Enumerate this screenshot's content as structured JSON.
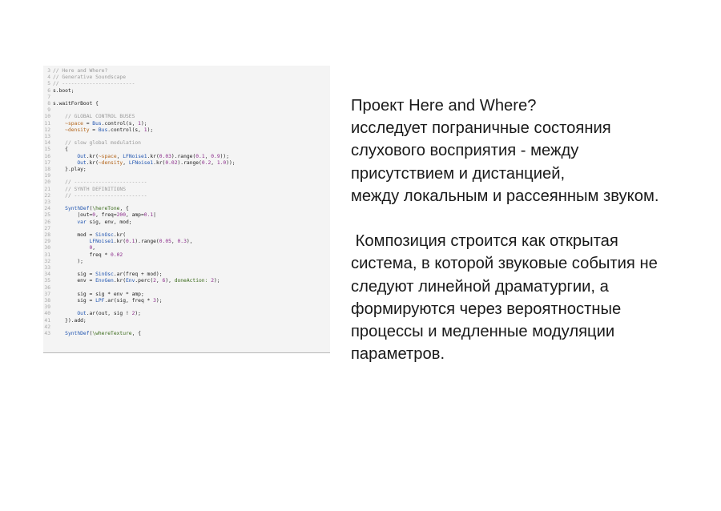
{
  "code": {
    "lines": [
      {
        "n": "3",
        "tokens": [
          {
            "t": "// Here and Where?",
            "c": "comment"
          }
        ]
      },
      {
        "n": "4",
        "tokens": [
          {
            "t": "// Generative Soundscape",
            "c": "comment"
          }
        ]
      },
      {
        "n": "5",
        "tokens": [
          {
            "t": "// ------------------------",
            "c": "comment"
          }
        ]
      },
      {
        "n": "6",
        "tokens": [
          {
            "t": "s.boot;",
            "c": "plain"
          }
        ]
      },
      {
        "n": "7",
        "tokens": []
      },
      {
        "n": "8",
        "tokens": [
          {
            "t": "s.waitForBoot {",
            "c": "plain"
          }
        ]
      },
      {
        "n": "9",
        "tokens": []
      },
      {
        "n": "10",
        "tokens": [
          {
            "t": "    // GLOBAL CONTROL BUSES",
            "c": "comment"
          }
        ]
      },
      {
        "n": "11",
        "tokens": [
          {
            "t": "    ",
            "c": "plain"
          },
          {
            "t": "~space",
            "c": "env"
          },
          {
            "t": " = ",
            "c": "plain"
          },
          {
            "t": "Bus",
            "c": "class"
          },
          {
            "t": ".control(s, ",
            "c": "plain"
          },
          {
            "t": "1",
            "c": "number"
          },
          {
            "t": ");",
            "c": "plain"
          }
        ]
      },
      {
        "n": "12",
        "tokens": [
          {
            "t": "    ",
            "c": "plain"
          },
          {
            "t": "~density",
            "c": "env"
          },
          {
            "t": " = ",
            "c": "plain"
          },
          {
            "t": "Bus",
            "c": "class"
          },
          {
            "t": ".control(s, ",
            "c": "plain"
          },
          {
            "t": "1",
            "c": "number"
          },
          {
            "t": ");",
            "c": "plain"
          }
        ]
      },
      {
        "n": "13",
        "tokens": []
      },
      {
        "n": "14",
        "tokens": [
          {
            "t": "    // slow global modulation",
            "c": "comment"
          }
        ]
      },
      {
        "n": "15",
        "tokens": [
          {
            "t": "    {",
            "c": "plain"
          }
        ]
      },
      {
        "n": "16",
        "tokens": [
          {
            "t": "        ",
            "c": "plain"
          },
          {
            "t": "Out",
            "c": "class"
          },
          {
            "t": ".kr(",
            "c": "plain"
          },
          {
            "t": "~space",
            "c": "env"
          },
          {
            "t": ", ",
            "c": "plain"
          },
          {
            "t": "LFNoise1",
            "c": "class"
          },
          {
            "t": ".kr(",
            "c": "plain"
          },
          {
            "t": "0.03",
            "c": "number"
          },
          {
            "t": ").range(",
            "c": "plain"
          },
          {
            "t": "0.1",
            "c": "number"
          },
          {
            "t": ", ",
            "c": "plain"
          },
          {
            "t": "0.9",
            "c": "number"
          },
          {
            "t": "));",
            "c": "plain"
          }
        ]
      },
      {
        "n": "17",
        "tokens": [
          {
            "t": "        ",
            "c": "plain"
          },
          {
            "t": "Out",
            "c": "class"
          },
          {
            "t": ".kr(",
            "c": "plain"
          },
          {
            "t": "~density",
            "c": "env"
          },
          {
            "t": ", ",
            "c": "plain"
          },
          {
            "t": "LFNoise1",
            "c": "class"
          },
          {
            "t": ".kr(",
            "c": "plain"
          },
          {
            "t": "0.02",
            "c": "number"
          },
          {
            "t": ").range(",
            "c": "plain"
          },
          {
            "t": "0.2",
            "c": "number"
          },
          {
            "t": ", ",
            "c": "plain"
          },
          {
            "t": "1.0",
            "c": "number"
          },
          {
            "t": "));",
            "c": "plain"
          }
        ]
      },
      {
        "n": "18",
        "tokens": [
          {
            "t": "    }.play;",
            "c": "plain"
          }
        ]
      },
      {
        "n": "19",
        "tokens": []
      },
      {
        "n": "20",
        "tokens": [
          {
            "t": "    // ------------------------",
            "c": "comment"
          }
        ]
      },
      {
        "n": "21",
        "tokens": [
          {
            "t": "    // SYNTH DEFINITIONS",
            "c": "comment"
          }
        ]
      },
      {
        "n": "22",
        "tokens": [
          {
            "t": "    // ------------------------",
            "c": "comment"
          }
        ]
      },
      {
        "n": "23",
        "tokens": []
      },
      {
        "n": "24",
        "tokens": [
          {
            "t": "    ",
            "c": "plain"
          },
          {
            "t": "SynthDef",
            "c": "class"
          },
          {
            "t": "(",
            "c": "plain"
          },
          {
            "t": "\\hereTone",
            "c": "symbol"
          },
          {
            "t": ", {",
            "c": "plain"
          }
        ]
      },
      {
        "n": "25",
        "tokens": [
          {
            "t": "        |out=",
            "c": "plain"
          },
          {
            "t": "0",
            "c": "number"
          },
          {
            "t": ", freq=",
            "c": "plain"
          },
          {
            "t": "200",
            "c": "number"
          },
          {
            "t": ", amp=",
            "c": "plain"
          },
          {
            "t": "0.1",
            "c": "number"
          },
          {
            "t": "|",
            "c": "plain"
          }
        ]
      },
      {
        "n": "26",
        "tokens": [
          {
            "t": "        ",
            "c": "plain"
          },
          {
            "t": "var",
            "c": "class"
          },
          {
            "t": " sig, env, mod;",
            "c": "plain"
          }
        ]
      },
      {
        "n": "27",
        "tokens": []
      },
      {
        "n": "28",
        "tokens": [
          {
            "t": "        mod = ",
            "c": "plain"
          },
          {
            "t": "SinOsc",
            "c": "class"
          },
          {
            "t": ".kr(",
            "c": "plain"
          }
        ]
      },
      {
        "n": "29",
        "tokens": [
          {
            "t": "            ",
            "c": "plain"
          },
          {
            "t": "LFNoise1",
            "c": "class"
          },
          {
            "t": ".kr(",
            "c": "plain"
          },
          {
            "t": "0.1",
            "c": "number"
          },
          {
            "t": ").range(",
            "c": "plain"
          },
          {
            "t": "0.05",
            "c": "number"
          },
          {
            "t": ", ",
            "c": "plain"
          },
          {
            "t": "0.3",
            "c": "number"
          },
          {
            "t": "),",
            "c": "plain"
          }
        ]
      },
      {
        "n": "30",
        "tokens": [
          {
            "t": "            ",
            "c": "plain"
          },
          {
            "t": "0",
            "c": "number"
          },
          {
            "t": ",",
            "c": "plain"
          }
        ]
      },
      {
        "n": "31",
        "tokens": [
          {
            "t": "            freq * ",
            "c": "plain"
          },
          {
            "t": "0.02",
            "c": "number"
          }
        ]
      },
      {
        "n": "32",
        "tokens": [
          {
            "t": "        );",
            "c": "plain"
          }
        ]
      },
      {
        "n": "33",
        "tokens": []
      },
      {
        "n": "34",
        "tokens": [
          {
            "t": "        sig = ",
            "c": "plain"
          },
          {
            "t": "SinOsc",
            "c": "class"
          },
          {
            "t": ".ar(freq + mod);",
            "c": "plain"
          }
        ]
      },
      {
        "n": "35",
        "tokens": [
          {
            "t": "        env = ",
            "c": "plain"
          },
          {
            "t": "EnvGen",
            "c": "class"
          },
          {
            "t": ".kr(",
            "c": "plain"
          },
          {
            "t": "Env",
            "c": "class"
          },
          {
            "t": ".perc(",
            "c": "plain"
          },
          {
            "t": "2",
            "c": "number"
          },
          {
            "t": ", ",
            "c": "plain"
          },
          {
            "t": "6",
            "c": "number"
          },
          {
            "t": "), ",
            "c": "plain"
          },
          {
            "t": "doneAction:",
            "c": "symbol"
          },
          {
            "t": " ",
            "c": "plain"
          },
          {
            "t": "2",
            "c": "number"
          },
          {
            "t": ");",
            "c": "plain"
          }
        ]
      },
      {
        "n": "36",
        "tokens": []
      },
      {
        "n": "37",
        "tokens": [
          {
            "t": "        sig = sig * env * amp;",
            "c": "plain"
          }
        ]
      },
      {
        "n": "38",
        "tokens": [
          {
            "t": "        sig = ",
            "c": "plain"
          },
          {
            "t": "LPF",
            "c": "class"
          },
          {
            "t": ".ar(sig, freq * ",
            "c": "plain"
          },
          {
            "t": "3",
            "c": "number"
          },
          {
            "t": ");",
            "c": "plain"
          }
        ]
      },
      {
        "n": "39",
        "tokens": []
      },
      {
        "n": "40",
        "tokens": [
          {
            "t": "        ",
            "c": "plain"
          },
          {
            "t": "Out",
            "c": "class"
          },
          {
            "t": ".ar(out, sig ! ",
            "c": "plain"
          },
          {
            "t": "2",
            "c": "number"
          },
          {
            "t": ");",
            "c": "plain"
          }
        ]
      },
      {
        "n": "41",
        "tokens": [
          {
            "t": "    }).add;",
            "c": "plain"
          }
        ]
      },
      {
        "n": "42",
        "tokens": []
      },
      {
        "n": "43",
        "tokens": [
          {
            "t": "    ",
            "c": "plain"
          },
          {
            "t": "SynthDef",
            "c": "class"
          },
          {
            "t": "(",
            "c": "plain"
          },
          {
            "t": "\\whereTexture",
            "c": "symbol"
          },
          {
            "t": ", {",
            "c": "plain"
          }
        ]
      }
    ]
  },
  "description": {
    "paragraphs": [
      {
        "lines": [
          "Проект Here and Where?",
          "исследует пограничные состояния",
          "слухового восприятия - между",
          "присутствием и дистанцией,",
          "между локальным и рассеянным звуком."
        ]
      },
      {
        "lines": [
          " Композиция строится как открытая",
          "система, в которой звуковые события не",
          "следуют линейной драматургии, а",
          "формируются через вероятностные",
          "процессы и медленные модуляции",
          "параметров."
        ]
      }
    ]
  }
}
